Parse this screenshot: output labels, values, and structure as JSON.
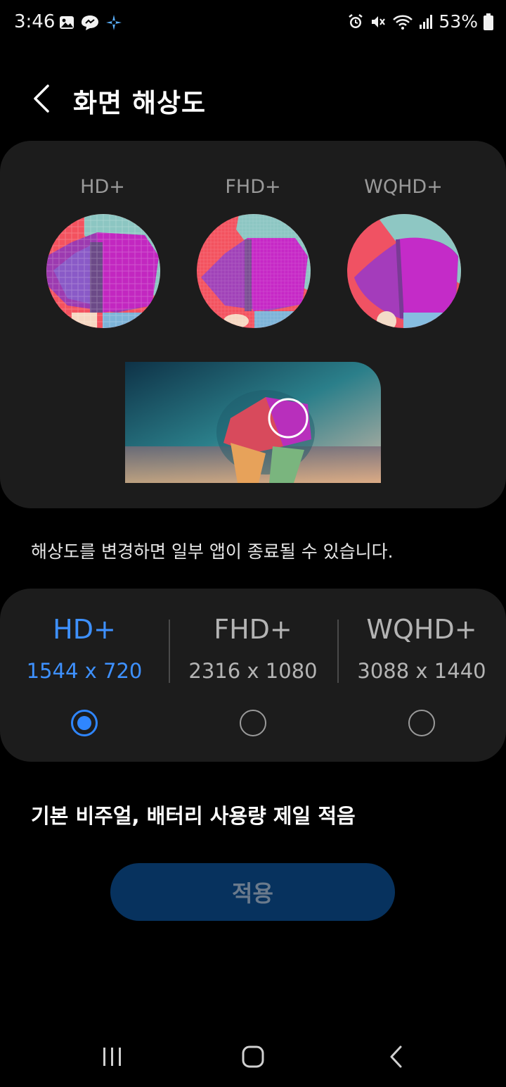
{
  "status_bar": {
    "time": "3:46",
    "battery_percent": "53%",
    "left_icons": [
      "gallery-icon",
      "messenger-icon",
      "sparkle-icon"
    ],
    "right_icons": [
      "alarm-icon",
      "mute-icon",
      "wifi-icon",
      "signal-icon",
      "battery-icon"
    ]
  },
  "header": {
    "title": "화면 해상도",
    "back_icon": "chevron-left-icon"
  },
  "preview": {
    "labels": [
      "HD+",
      "FHD+",
      "WQHD+"
    ]
  },
  "warning": "해상도를 변경하면 일부 앱이 종료될 수 있습니다.",
  "resolutions": [
    {
      "name": "HD+",
      "value": "1544 x 720",
      "selected": true
    },
    {
      "name": "FHD+",
      "value": "2316 x 1080",
      "selected": false
    },
    {
      "name": "WQHD+",
      "value": "3088 x 1440",
      "selected": false
    }
  ],
  "description": "기본 비주얼, 배터리 사용량 제일 적음",
  "apply_label": "적용",
  "colors": {
    "accent": "#2f86ff",
    "card_bg": "#1c1c1c",
    "apply_bg": "#07325e"
  },
  "nav": [
    "recents-icon",
    "home-icon",
    "back-icon"
  ]
}
